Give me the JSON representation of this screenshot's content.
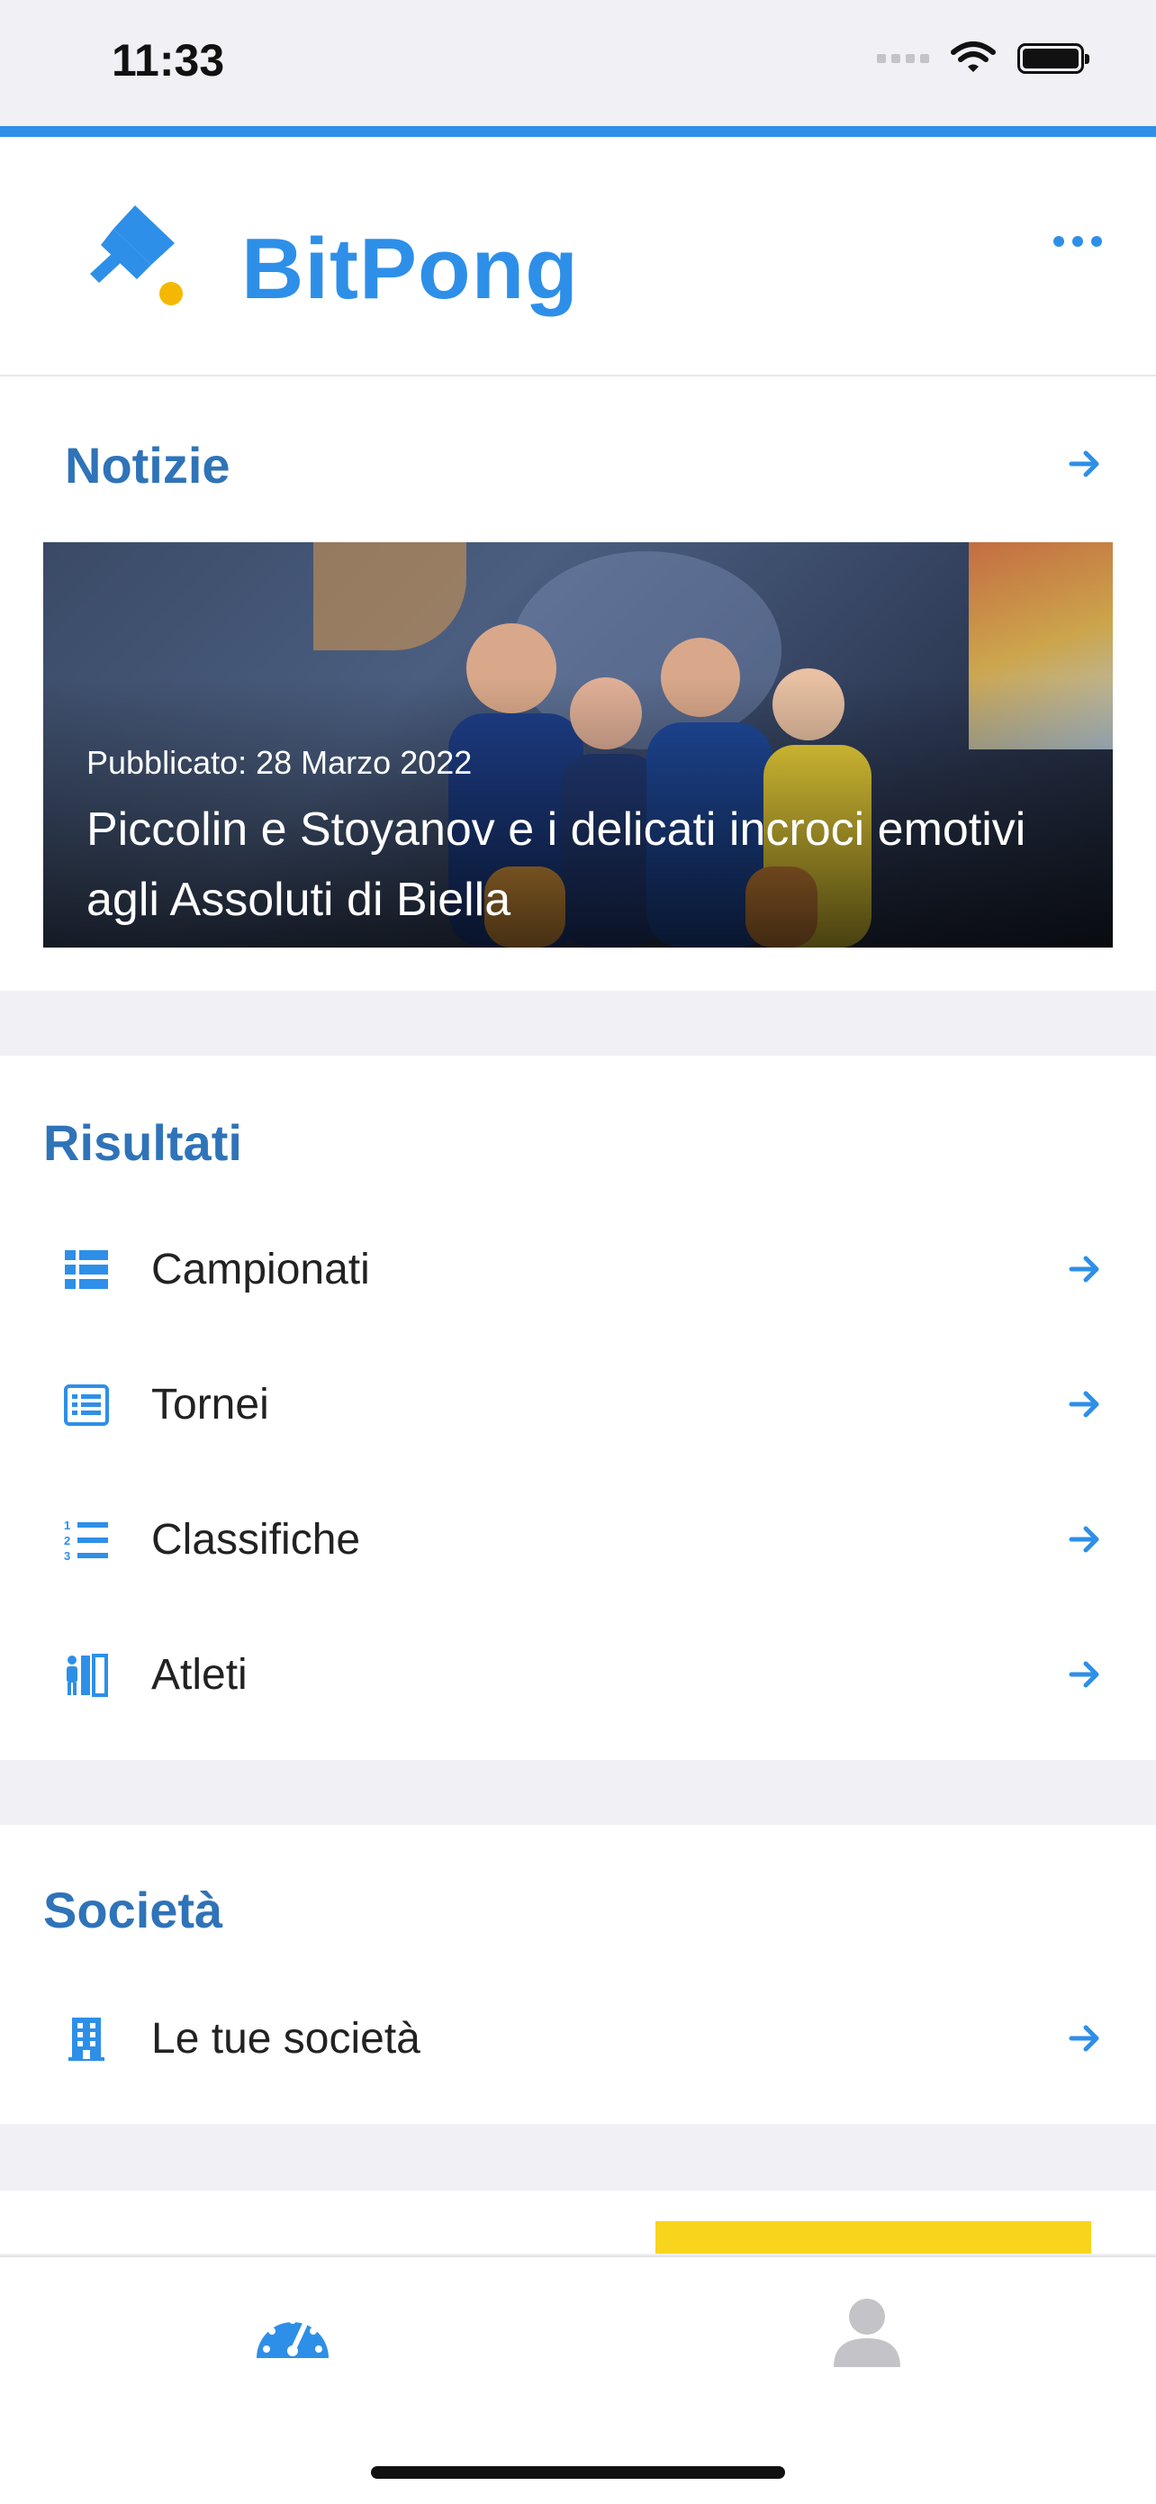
{
  "status_bar": {
    "time": "11:33"
  },
  "header": {
    "brand": "BitPong"
  },
  "news": {
    "title": "Notizie",
    "card": {
      "date": "Pubblicato: 28 Marzo 2022",
      "headline": "Piccolin e Stoyanov e i delicati incroci emotivi agli Assoluti di Biella"
    }
  },
  "results": {
    "title": "Risultati",
    "items": [
      {
        "label": "Campionati",
        "icon": "table-list-icon"
      },
      {
        "label": "Tornei",
        "icon": "list-alt-icon"
      },
      {
        "label": "Classifiche",
        "icon": "ordered-list-icon"
      },
      {
        "label": "Atleti",
        "icon": "athletes-icon"
      }
    ]
  },
  "clubs": {
    "title": "Società",
    "items": [
      {
        "label": "Le tue società",
        "icon": "building-icon"
      }
    ]
  },
  "colors": {
    "accent": "#2e8fe8",
    "title_blue": "#2f73b8",
    "yellow": "#f9d41c"
  },
  "tabs": [
    {
      "icon": "dashboard-icon",
      "active": true
    },
    {
      "icon": "profile-icon",
      "active": false
    }
  ]
}
